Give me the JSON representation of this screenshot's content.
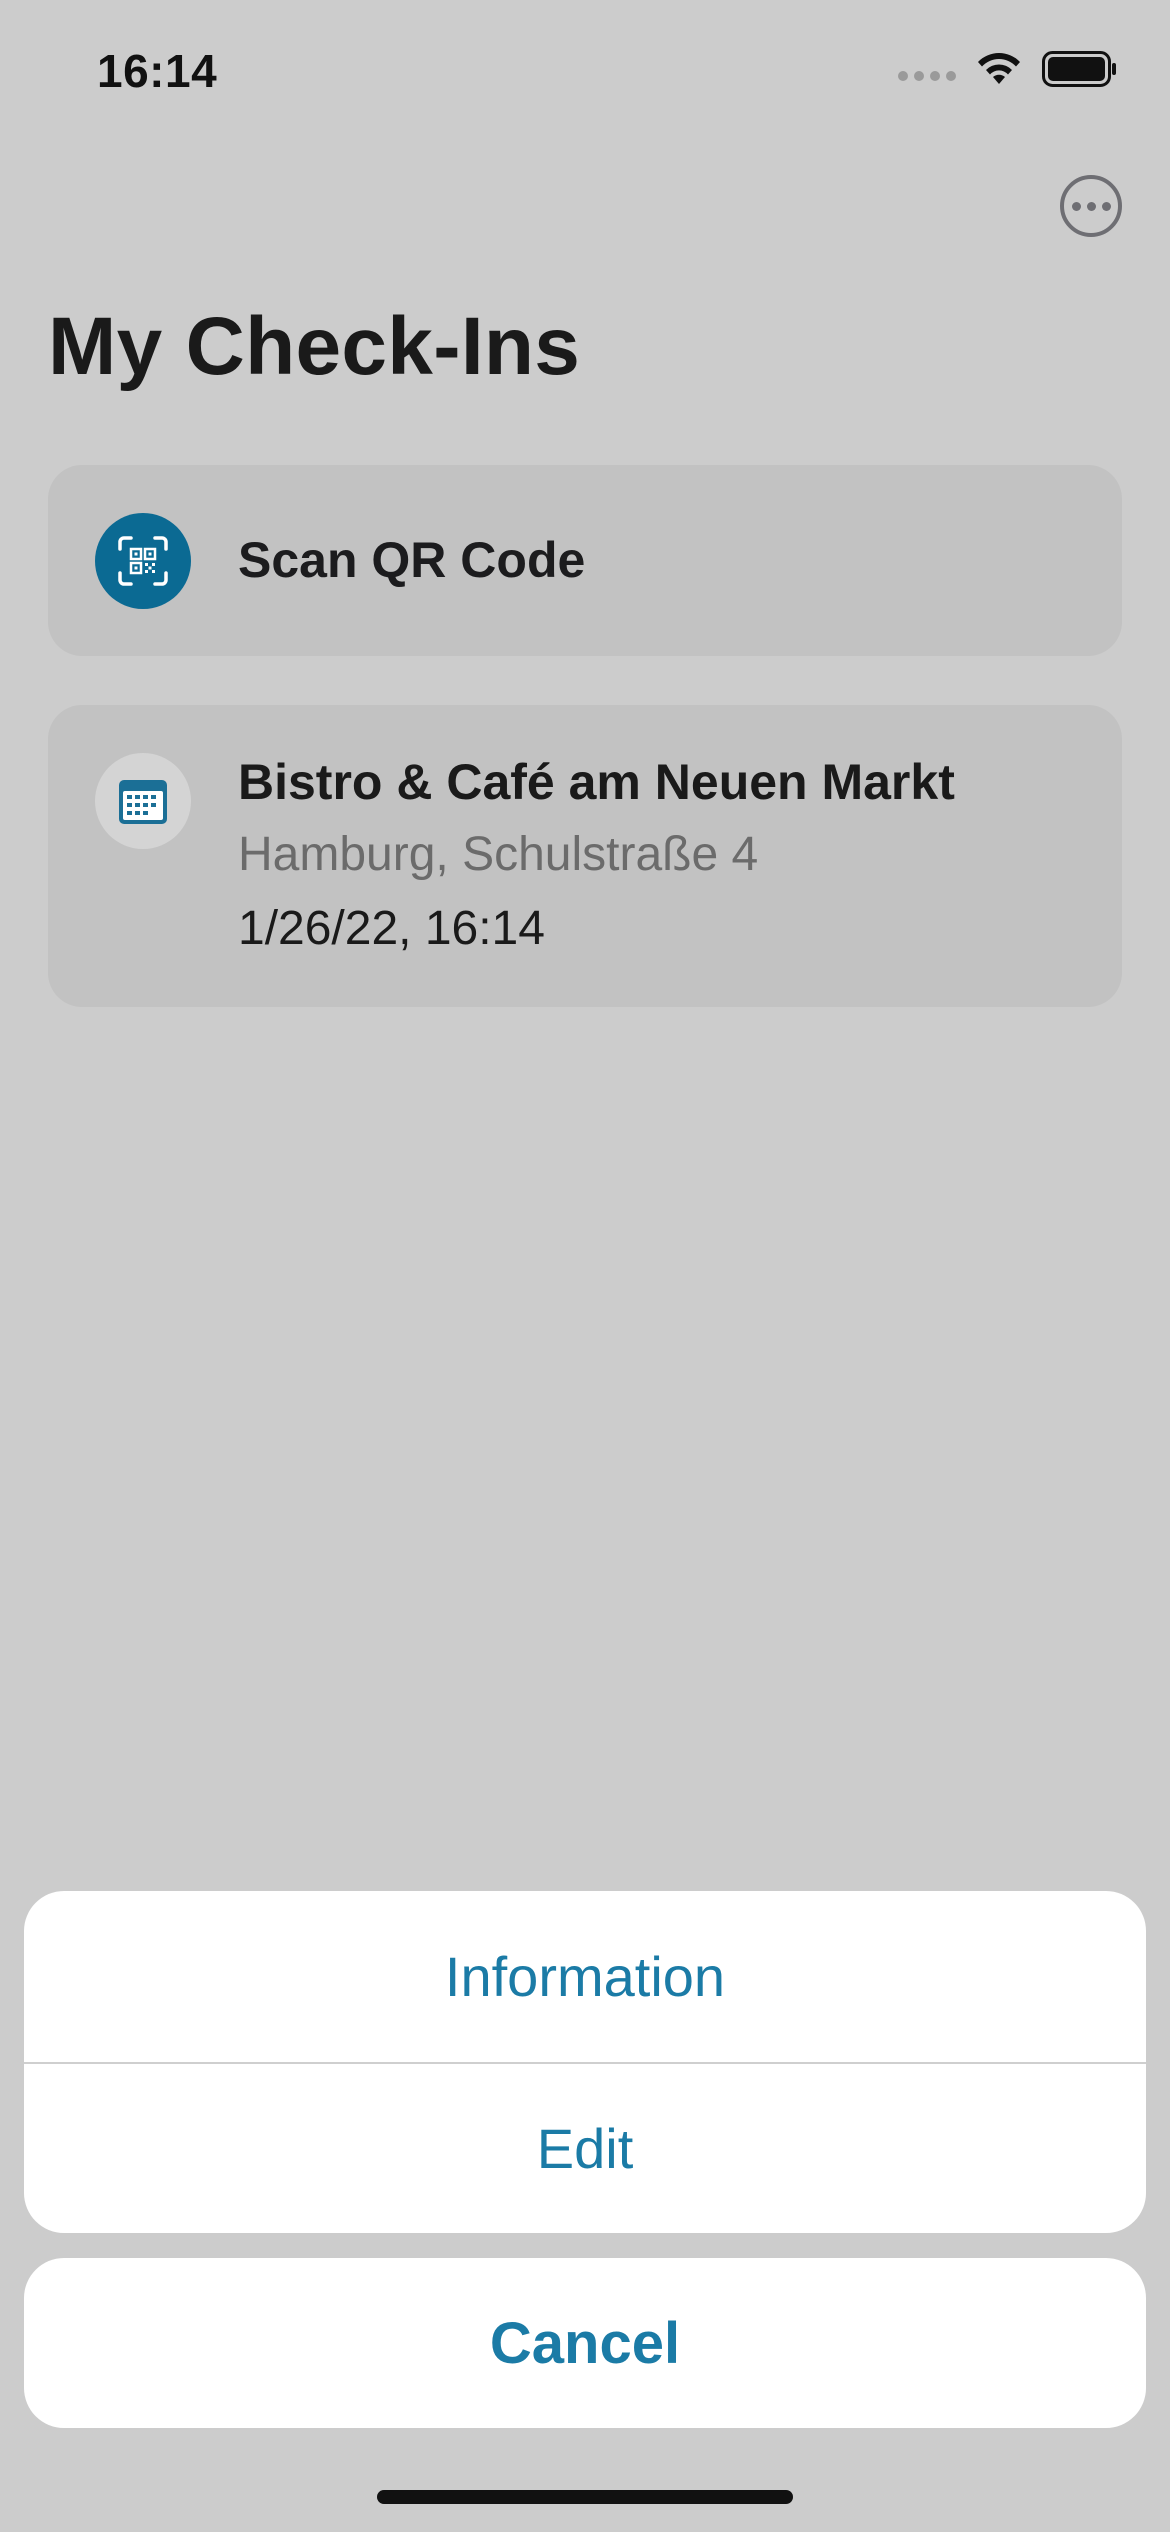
{
  "status_bar": {
    "time": "16:14"
  },
  "header": {
    "title": "My Check-Ins",
    "more_icon": "ellipsis-circle-icon"
  },
  "scan_card": {
    "label": "Scan QR Code",
    "icon": "qr-scan-icon",
    "icon_color": "#0b6a93"
  },
  "checkins": [
    {
      "name": "Bistro & Café am Neuen Markt",
      "address": "Hamburg, Schulstraße 4",
      "datetime": "1/26/22, 16:14",
      "icon": "calendar-icon"
    }
  ],
  "action_sheet": {
    "actions": [
      "Information",
      "Edit"
    ],
    "cancel_label": "Cancel",
    "accent_color": "#1b7ba6"
  }
}
